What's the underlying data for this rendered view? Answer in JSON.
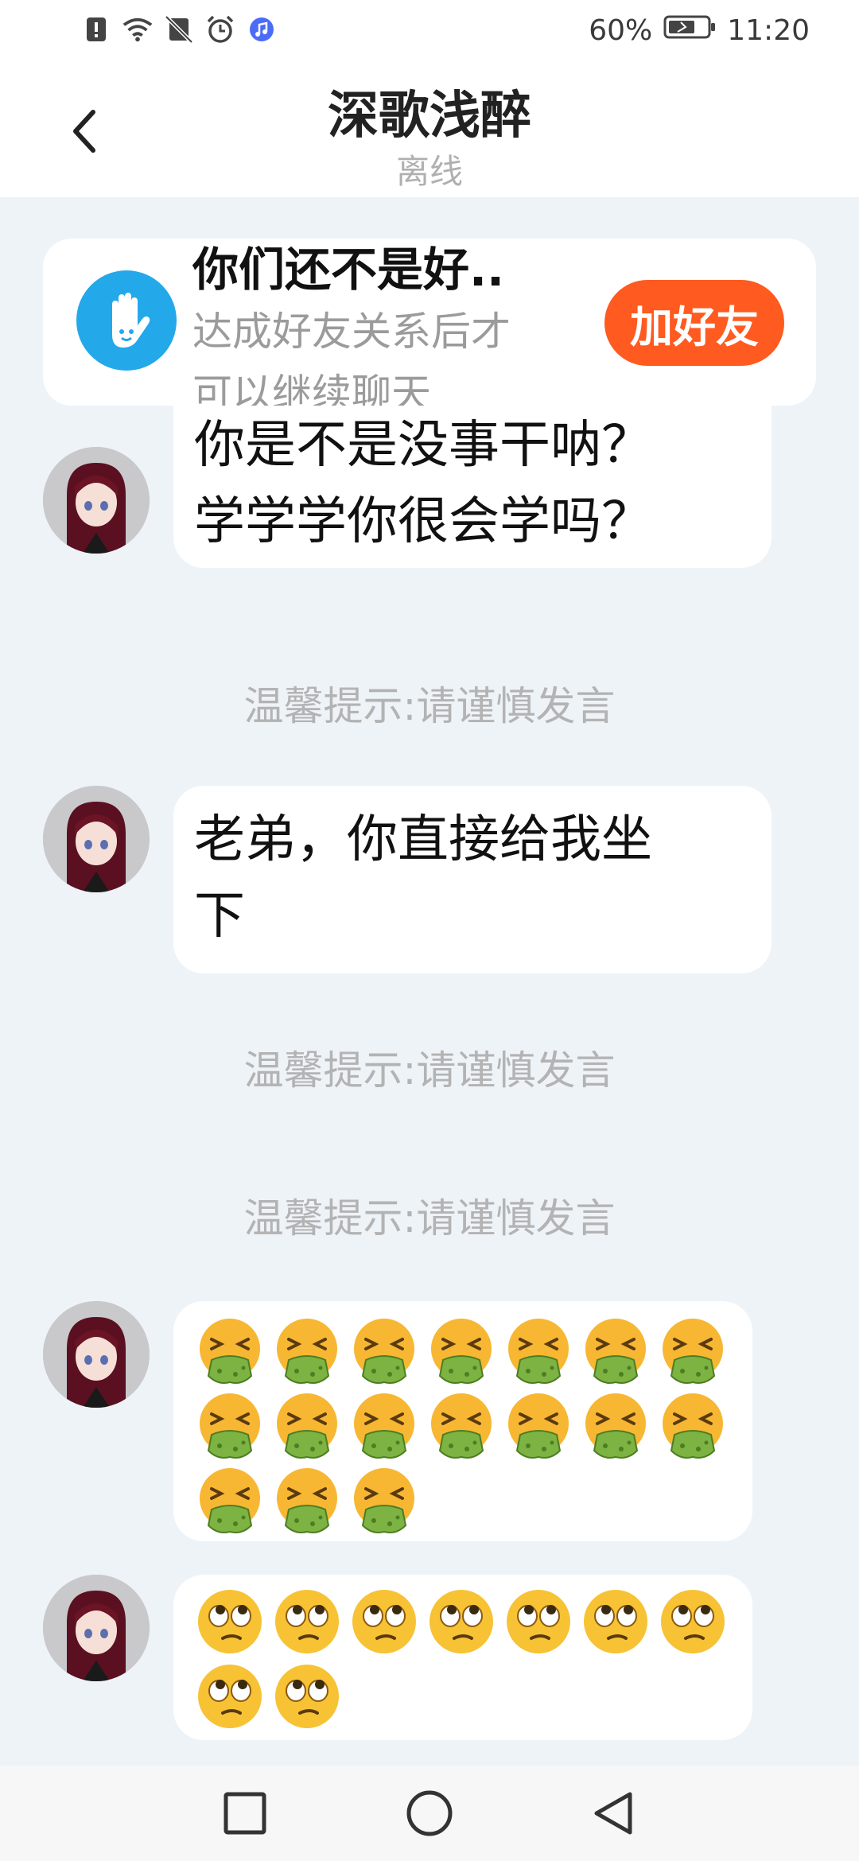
{
  "status_bar": {
    "battery": "60%",
    "time": "11:20",
    "icons": [
      "alert-icon",
      "wifi-icon",
      "no-sim-icon",
      "alarm-icon",
      "music-icon",
      "battery-icon"
    ]
  },
  "header": {
    "title": "深歌浅醉",
    "subtitle": "离线",
    "back_icon": "chevron-left-icon"
  },
  "banner": {
    "title": "你们还不是好..",
    "desc_line1": "达成好友关系后才",
    "desc_line2": "可以继续聊天",
    "button_label": "加好友",
    "icon": "hand-icon",
    "accent": "#ff5a1f",
    "icon_color": "#23a8ea"
  },
  "messages": {
    "m1": {
      "line1": "你是不是没事干呐？",
      "line2": "学学学你很会学吗？"
    },
    "tip1": "温馨提示:请谨慎发言",
    "m2": {
      "line1": "老弟，你直接给我坐",
      "line2": "下"
    },
    "tip2": "温馨提示:请谨慎发言",
    "tip3": "温馨提示:请谨慎发言",
    "m3": {
      "emoji": "vomiting-face",
      "count": 17
    },
    "m4": {
      "emoji": "eye-roll-face",
      "count": 9
    }
  },
  "nav": {
    "icons": [
      "recent-apps-icon",
      "home-icon",
      "back-icon"
    ]
  }
}
